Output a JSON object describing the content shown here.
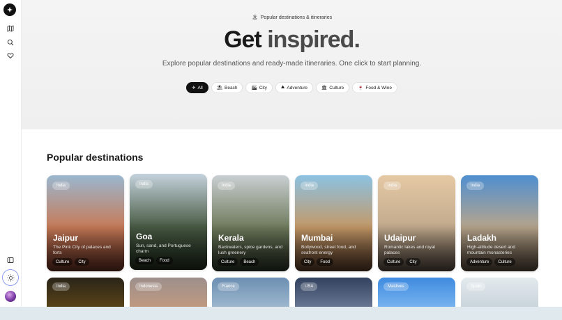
{
  "sidebar": {
    "icons": [
      "logo-icon",
      "map-icon",
      "search-icon",
      "heart-icon",
      "panel-icon",
      "sun-icon",
      "avatar"
    ]
  },
  "hero": {
    "eyebrow_icon": "🏝",
    "eyebrow": "Popular destinations & itineraries",
    "title_a": "Get ",
    "title_b": "inspired.",
    "subtitle": "Explore popular destinations and ready-made itineraries. One click to start planning."
  },
  "filters": [
    {
      "icon": "✈",
      "label": "All",
      "active": true
    },
    {
      "icon": "⛱",
      "label": "Beach"
    },
    {
      "icon": "🏙",
      "label": "City"
    },
    {
      "icon": "⛰",
      "label": "Adventure"
    },
    {
      "icon": "🏛",
      "label": "Culture"
    },
    {
      "icon": "🍷",
      "label": "Food & Wine"
    }
  ],
  "section": {
    "title": "Popular destinations"
  },
  "destinations": [
    {
      "country": "India",
      "name": "Jaipur",
      "desc": "The Pink City of palaces and forts",
      "tags": [
        "Culture",
        "City"
      ],
      "colors": [
        "#9ab7cf",
        "#c77a57",
        "#6b3325"
      ]
    },
    {
      "country": "India",
      "name": "Goa",
      "desc": "Sun, sand, and Portuguese charm",
      "tags": [
        "Beach",
        "Food"
      ],
      "colors": [
        "#c4d2dc",
        "#4a5d46",
        "#24301f"
      ]
    },
    {
      "country": "India",
      "name": "Kerala",
      "desc": "Backwaters, spice gardens, and lush greenery",
      "tags": [
        "Culture",
        "Beach"
      ],
      "colors": [
        "#c9cfd2",
        "#6f7a5c",
        "#2a3526"
      ]
    },
    {
      "country": "India",
      "name": "Mumbai",
      "desc": "Bollywood, street food, and seafront energy",
      "tags": [
        "City",
        "Food"
      ],
      "colors": [
        "#8cc2e2",
        "#c49867",
        "#5e3f2a"
      ]
    },
    {
      "country": "India",
      "name": "Udaipur",
      "desc": "Romantic lakes and royal palaces",
      "tags": [
        "Culture",
        "City"
      ],
      "colors": [
        "#e5c9a4",
        "#c2aa8d",
        "#5a4d44"
      ]
    },
    {
      "country": "India",
      "name": "Ladakh",
      "desc": "High-altitude desert and mountain monasteries",
      "tags": [
        "Adventure",
        "Culture"
      ],
      "colors": [
        "#4f8fd0",
        "#b7a58c",
        "#5c4d3e"
      ]
    }
  ],
  "more_destinations": [
    {
      "country": "India",
      "colors": [
        "#2a2418",
        "#5a4418"
      ]
    },
    {
      "country": "Indonesia",
      "colors": [
        "#9d8f8c",
        "#c19a80"
      ]
    },
    {
      "country": "France",
      "colors": [
        "#6d8fb2",
        "#9fb8cf"
      ]
    },
    {
      "country": "USA",
      "colors": [
        "#32425e",
        "#6a7895"
      ]
    },
    {
      "country": "Maldives",
      "colors": [
        "#3f8be0",
        "#79b4ef"
      ]
    },
    {
      "country": "Spain",
      "colors": [
        "#e4eaee",
        "#c8d3da"
      ]
    }
  ]
}
